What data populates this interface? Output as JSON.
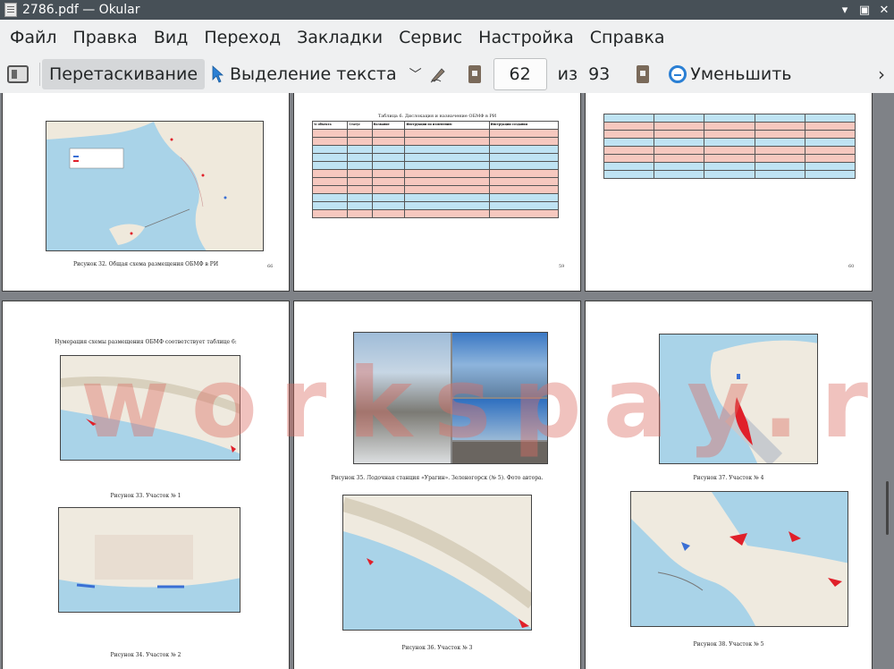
{
  "window": {
    "title": "2786.pdf  — Okular"
  },
  "menu": [
    "Файл",
    "Правка",
    "Вид",
    "Переход",
    "Закладки",
    "Сервис",
    "Настройка",
    "Справка"
  ],
  "toolbar": {
    "browse_label": "Перетаскивание",
    "text_select_label": "Выделение текста",
    "page_current": "62",
    "page_of": "из",
    "page_total": "93",
    "zoom_out_label": "Уменьшить"
  },
  "watermark": "workspay.ru",
  "pages": {
    "p1": {
      "caption": "Рисунок 32. Общая схема размещения ОБМФ в РИ",
      "num": "66"
    },
    "p2": {
      "title": "Таблица 6. Дислокация и назначение ОБМФ в РИ",
      "headers": [
        "№ объекта",
        "Статус",
        "Название",
        "Инструкции по изменению",
        "Инструкции создания"
      ],
      "num": "59"
    },
    "p3": {
      "num": "60"
    },
    "p4": {
      "intro": "Нумерация схемы размещения ОБМФ соответствует  таблице 6:",
      "cap1": "Рисунок 33. Участок № 1",
      "cap2": "Рисунок 34. Участок № 2"
    },
    "p5": {
      "cap1": "Рисунок 35. Лодочная станция «Урагин». Зеленогорск (№ 5). Фото автора.",
      "cap2": "Рисунок 36. Участок № 3"
    },
    "p6": {
      "cap1": "Рисунок 37. Участок № 4",
      "cap2": "Рисунок 38. Участок № 5"
    }
  },
  "colors": {
    "accent": "#2a7fd4",
    "map_water": "#a9d3e8",
    "map_land": "#f0ece2",
    "highlight_red": "#e0202a"
  }
}
